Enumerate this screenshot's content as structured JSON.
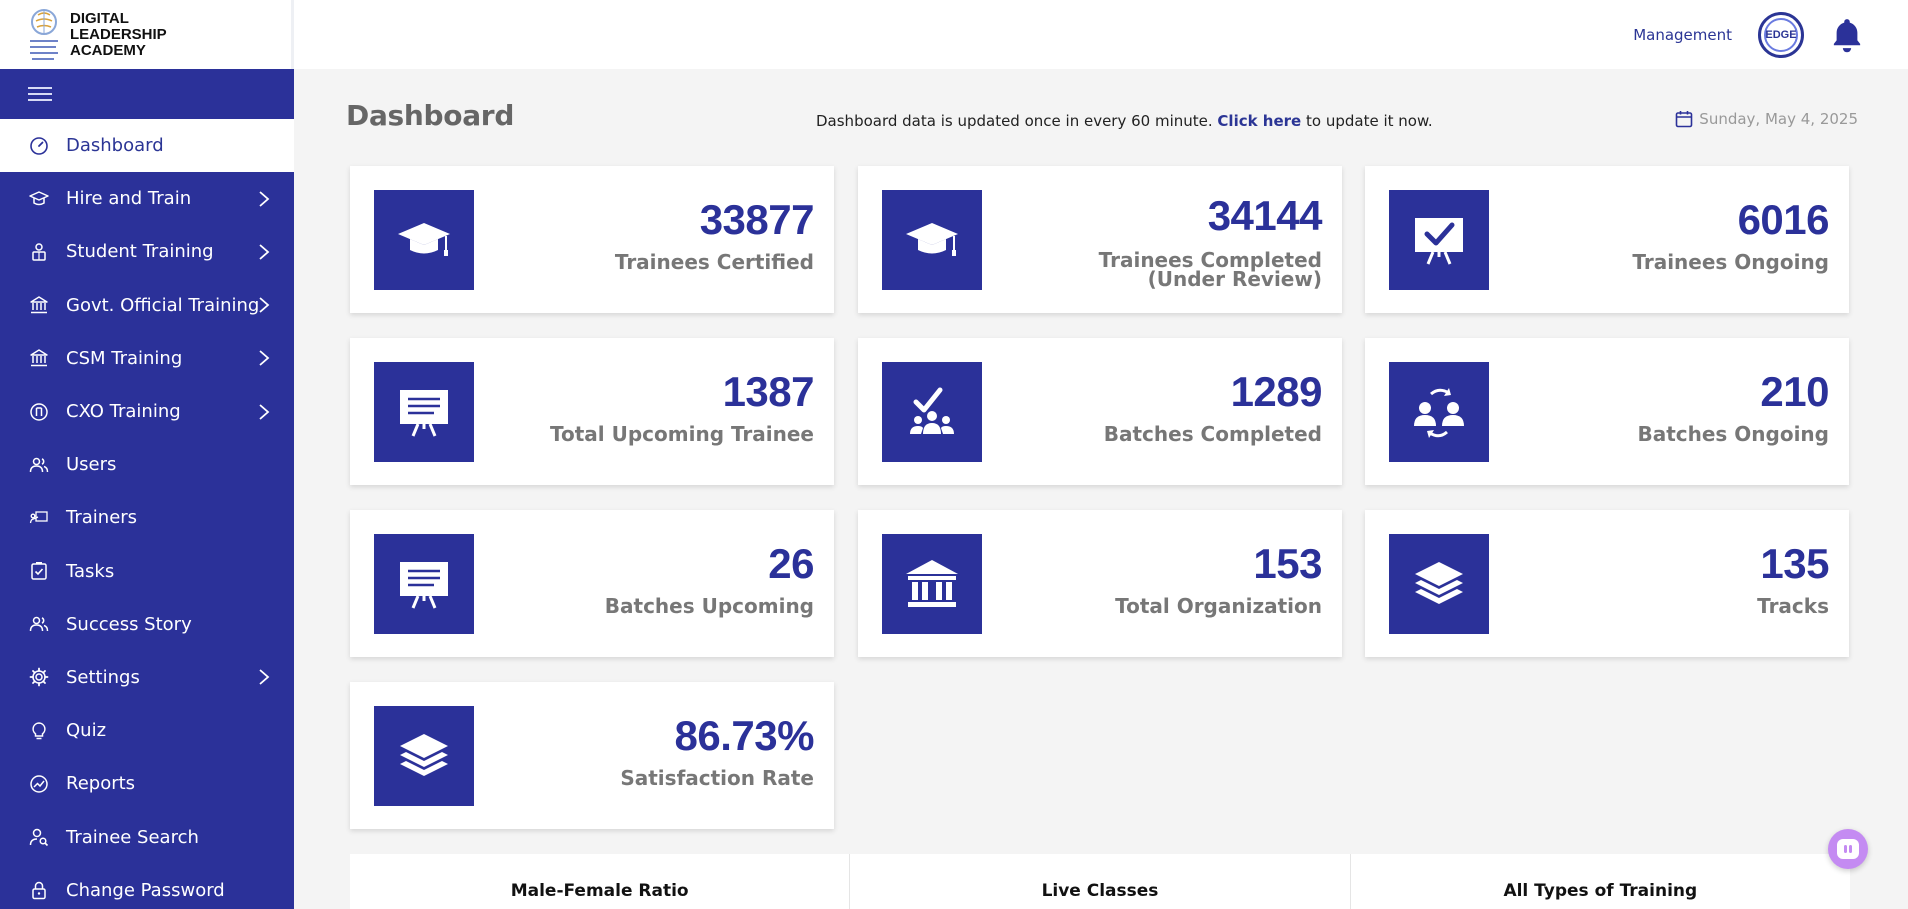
{
  "brand": {
    "name_line1": "DIGITAL",
    "name_line2": "LEADERSHIP",
    "name_line3": "ACADEMY"
  },
  "header": {
    "management_label": "Management",
    "avatar_text": "EDGE"
  },
  "sidebar": {
    "items": [
      {
        "label": "Dashboard",
        "icon": "gauge-icon",
        "active": true,
        "has_children": false
      },
      {
        "label": "Hire and Train",
        "icon": "graduation-cap-icon",
        "has_children": true
      },
      {
        "label": "Student Training",
        "icon": "student-icon",
        "has_children": true
      },
      {
        "label": "Govt. Official Training",
        "icon": "bank-icon",
        "has_children": true
      },
      {
        "label": "CSM Training",
        "icon": "bank-icon",
        "has_children": true
      },
      {
        "label": "CXO Training",
        "icon": "cxo-icon",
        "has_children": true
      },
      {
        "label": "Users",
        "icon": "users-icon",
        "has_children": false
      },
      {
        "label": "Trainers",
        "icon": "trainer-icon",
        "has_children": false
      },
      {
        "label": "Tasks",
        "icon": "tasks-icon",
        "has_children": false
      },
      {
        "label": "Success Story",
        "icon": "users-icon",
        "has_children": false
      },
      {
        "label": "Settings",
        "icon": "gear-icon",
        "has_children": true
      },
      {
        "label": "Quiz",
        "icon": "bulb-icon",
        "has_children": false
      },
      {
        "label": "Reports",
        "icon": "reports-icon",
        "has_children": false
      },
      {
        "label": "Trainee Search",
        "icon": "user-search-icon",
        "has_children": false
      },
      {
        "label": "Change Password",
        "icon": "lock-icon",
        "has_children": false
      }
    ]
  },
  "main": {
    "title": "Dashboard",
    "update_note_prefix": "Dashboard data is updated once in every 60 minute.",
    "update_link": "Click here",
    "update_note_suffix": "to update it now.",
    "date": "Sunday, May 4, 2025"
  },
  "cards": [
    {
      "value": "33877",
      "label": "Trainees Certified",
      "icon": "graduation-cap-icon"
    },
    {
      "value": "34144",
      "label": "Trainees Completed",
      "label2": "(Under Review)",
      "icon": "graduation-cap-icon"
    },
    {
      "value": "6016",
      "label": "Trainees Ongoing",
      "icon": "board-check-icon"
    },
    {
      "value": "1387",
      "label": "Total Upcoming Trainee",
      "icon": "presentation-board-icon"
    },
    {
      "value": "1289",
      "label": "Batches Completed",
      "icon": "group-check-icon"
    },
    {
      "value": "210",
      "label": "Batches Ongoing",
      "icon": "users-cycle-icon"
    },
    {
      "value": "26",
      "label": "Batches Upcoming",
      "icon": "presentation-board-icon"
    },
    {
      "value": "153",
      "label": "Total Organization",
      "icon": "institution-icon"
    },
    {
      "value": "135",
      "label": "Tracks",
      "icon": "layers-icon"
    },
    {
      "value": "86.73%",
      "label": "Satisfaction Rate",
      "icon": "layers-icon"
    }
  ],
  "bottom_panels": [
    "Male-Female Ratio",
    "Live Classes",
    "All Types of Training"
  ],
  "colors": {
    "primary": "#2b3199",
    "sidebar_bg": "#2b3199",
    "page_bg": "#f4f4f4",
    "muted_text": "#777777"
  }
}
